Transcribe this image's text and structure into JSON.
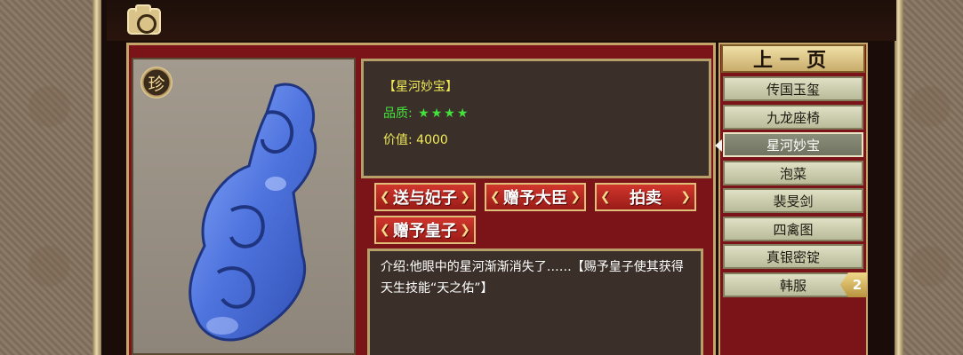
{
  "item": {
    "badge": "珍",
    "name": "【星河妙宝】",
    "quality_label": "品质:",
    "quality_stars": "★★★★",
    "value_text": "价值: 4000",
    "description": "介绍:他眼中的星河渐渐消失了……【赐予皇子使其获得天生技能“天之佑”】"
  },
  "actions": {
    "give_consort": "送与妃子",
    "give_minister": "赠予大臣",
    "auction": "拍卖",
    "give_prince": "赠予皇子"
  },
  "list": {
    "prev_page": "上一页",
    "items": [
      "传国玉玺",
      "九龙座椅",
      "星河妙宝",
      "泡菜",
      "裴旻剑",
      "四禽图",
      "真银密锭",
      "韩服"
    ],
    "selected_index": 2,
    "count_badge": "2"
  },
  "colors": {
    "frame_red": "#7a1418",
    "gold_border": "#c4a46a",
    "jade_blue": "#5b7fe0",
    "button_red": "#c1302a",
    "name_yellow": "#f0ea58",
    "quality_green": "#43e23c"
  },
  "icons": [
    "camera-icon",
    "rarity-badge-icon"
  ]
}
